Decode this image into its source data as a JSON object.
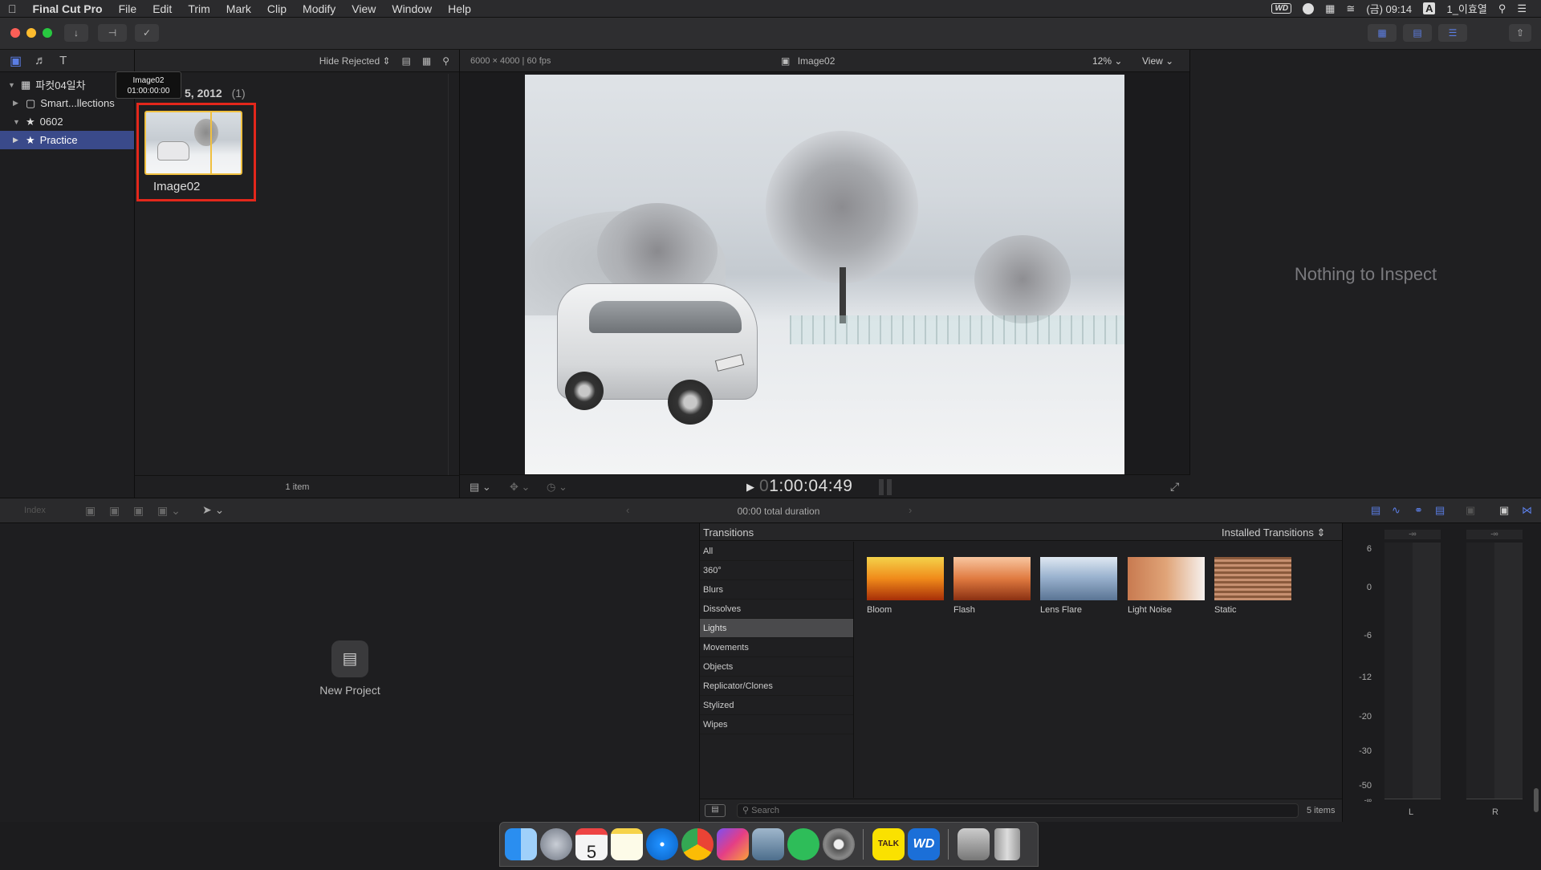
{
  "menubar": {
    "app": "Final Cut Pro",
    "items": [
      "File",
      "Edit",
      "Trim",
      "Mark",
      "Clip",
      "Modify",
      "View",
      "Window",
      "Help"
    ],
    "status": {
      "wd": "WD",
      "clock": "(금) 09:14",
      "input": "A",
      "user": "1_이효열"
    }
  },
  "toolbar": {},
  "libraries": {
    "library_name": "파컷04일차",
    "items": [
      {
        "label": "Smart...llections"
      },
      {
        "label": "0602"
      },
      {
        "label": "Practice"
      }
    ]
  },
  "browser": {
    "filter_label": "Hide Rejected",
    "date_header": "5, 2012",
    "date_count": "(1)",
    "clip_name": "Image02",
    "tooltip_name": "Image02",
    "tooltip_time": "01:00:00:00",
    "footer": "1 item"
  },
  "viewer": {
    "format": "6000 × 4000 | 60 fps",
    "title": "Image02",
    "zoom": "12%",
    "view_label": "View",
    "timecode_dim": "0",
    "timecode": "1:00:04:49"
  },
  "inspector": {
    "empty_text": "Nothing to Inspect"
  },
  "timeline_bar": {
    "index_label": "Index",
    "duration": "00:00 total duration"
  },
  "timeline": {
    "new_project": "New Project"
  },
  "transitions": {
    "header": "Transitions",
    "source": "Installed Transitions",
    "categories": [
      "All",
      "360°",
      "Blurs",
      "Dissolves",
      "Lights",
      "Movements",
      "Objects",
      "Replicator/Clones",
      "Stylized",
      "Wipes"
    ],
    "selected_category": "Lights",
    "thumbs": [
      {
        "name": "Bloom"
      },
      {
        "name": "Flash"
      },
      {
        "name": "Lens Flare"
      },
      {
        "name": "Light Noise"
      },
      {
        "name": "Static"
      }
    ],
    "search_placeholder": "Search",
    "count": "5 items"
  },
  "meters": {
    "peak_l": "-∞",
    "peak_r": "-∞",
    "scale": [
      "6",
      "0",
      "-6",
      "-12",
      "-20",
      "-30",
      "-50",
      "-∞"
    ],
    "left": "L",
    "right": "R"
  },
  "dock": {
    "calendar_day": "5",
    "kakao": "TALK",
    "wd": "WD"
  },
  "colors": {
    "selection": "#3a4a8a",
    "highlight_box": "#e3271b",
    "accent": "#5b7ee5"
  }
}
